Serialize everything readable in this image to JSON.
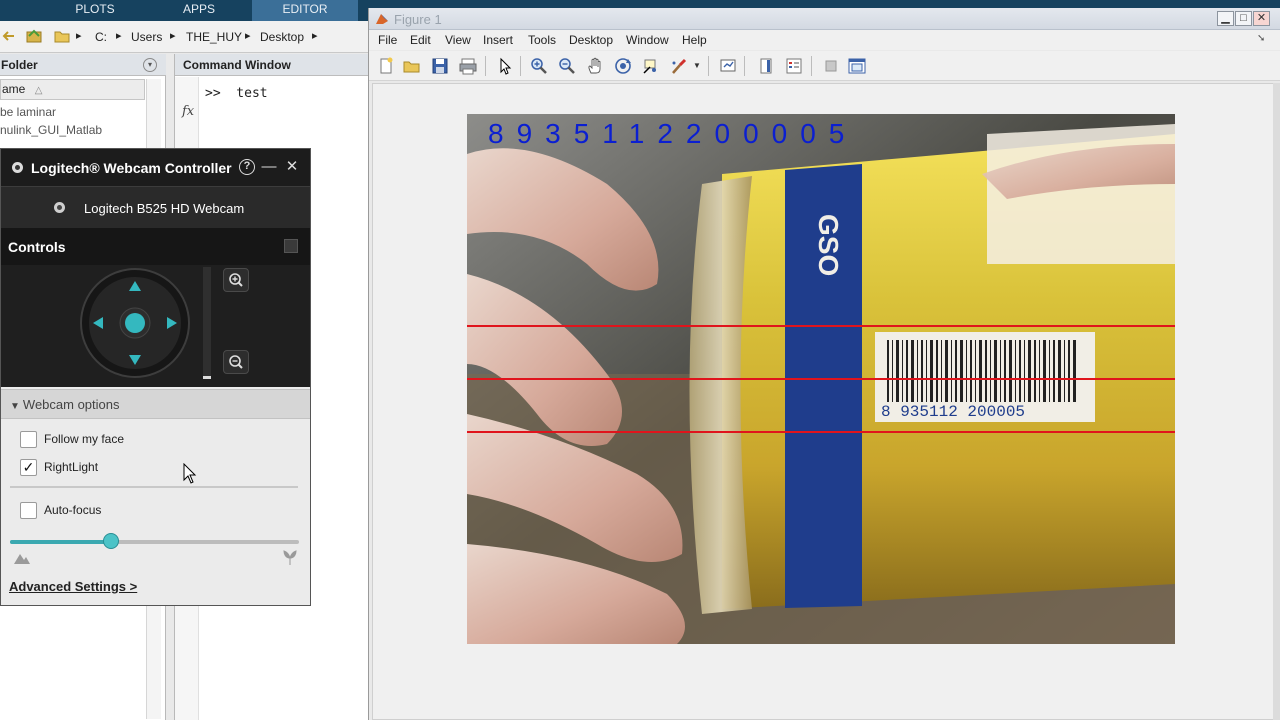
{
  "ribbon": {
    "tabs": [
      "PLOTS",
      "APPS",
      "EDITOR"
    ],
    "active_tab": "EDITOR"
  },
  "address": {
    "path": [
      "C:",
      "Users",
      "THE_HUY",
      "Desktop"
    ]
  },
  "current_folder": {
    "title": "Folder",
    "column_header": "ame",
    "sort_indicator": "△",
    "items": [
      "be laminar",
      "nulink_GUI_Matlab"
    ]
  },
  "command_window": {
    "title": "Command Window",
    "prompt_line": ">>  test",
    "fx_symbol": "fx"
  },
  "webcam_controller": {
    "title": "Logitech® Webcam Controller",
    "help_icon": "?",
    "minimize_icon": "—",
    "close_icon": "✕",
    "device_name": "Logitech B525 HD Webcam",
    "controls_label": "Controls",
    "zoom_in": "+",
    "zoom_out": "−",
    "webcam_options_label": "Webcam options",
    "follow_face": {
      "label": "Follow my face",
      "checked": false,
      "mark": ""
    },
    "rightlight": {
      "label": "RightLight",
      "checked": true,
      "mark": "✓"
    },
    "autofocus": {
      "label": "Auto-focus",
      "checked": false,
      "mark": ""
    },
    "focus_level": 0.35,
    "advanced_settings": "Advanced Settings >",
    "accent_color": "#3aa8b0"
  },
  "figure": {
    "title": "Figure 1",
    "menu": [
      "File",
      "Edit",
      "View",
      "Insert",
      "Tools",
      "Desktop",
      "Window",
      "Help"
    ],
    "barcode_digits": "8935112200005",
    "can_barcode_text": "8 935112 200005",
    "can_brand_text": "GSO",
    "digit_color": "#0b1fd1",
    "scanline_color": "#e0141c"
  }
}
